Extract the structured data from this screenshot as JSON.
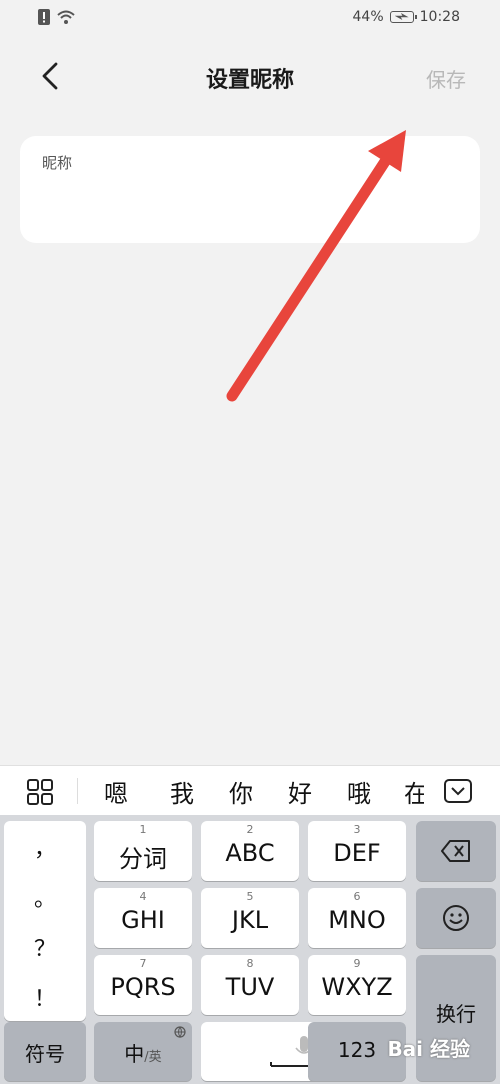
{
  "status": {
    "battery": "44%",
    "time": "10:28"
  },
  "header": {
    "title": "设置昵称",
    "save": "保存"
  },
  "card": {
    "label": "昵称"
  },
  "candidates": [
    "嗯",
    "我",
    "你",
    "好",
    "哦",
    "在"
  ],
  "keyboard": {
    "punct": [
      "，",
      "。",
      "？",
      "！"
    ],
    "rows": [
      [
        {
          "num": "1",
          "label": "分词"
        },
        {
          "num": "2",
          "label": "ABC"
        },
        {
          "num": "3",
          "label": "DEF"
        }
      ],
      [
        {
          "num": "4",
          "label": "GHI"
        },
        {
          "num": "5",
          "label": "JKL"
        },
        {
          "num": "6",
          "label": "MNO"
        }
      ],
      [
        {
          "num": "7",
          "label": "PQRS"
        },
        {
          "num": "8",
          "label": "TUV"
        },
        {
          "num": "9",
          "label": "WXYZ"
        }
      ]
    ],
    "enter": "换行",
    "symbols": "符号",
    "lang_main": "中",
    "lang_sub": "/英",
    "numbers": "123"
  },
  "watermark": "Bai 经验"
}
